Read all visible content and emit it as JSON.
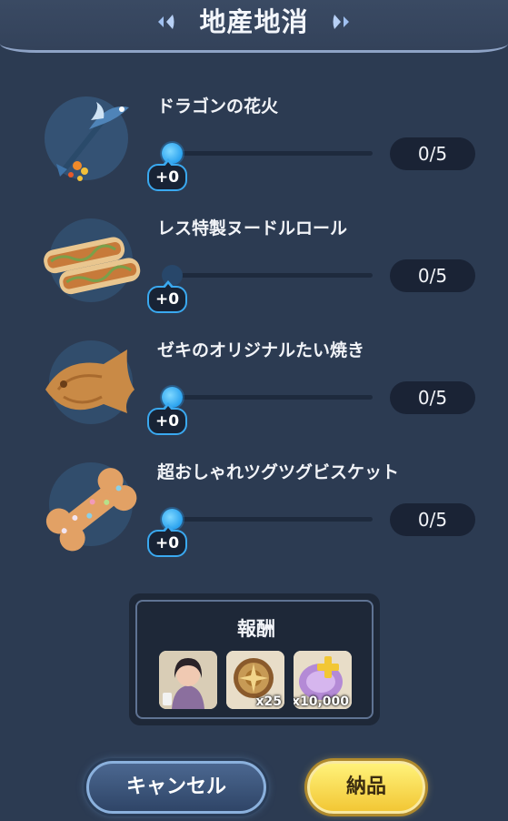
{
  "header": {
    "title": "地産地消"
  },
  "items": [
    {
      "name": "ドラゴンの花火",
      "count": "0/5",
      "delta": "+0",
      "icon": "dragon-firework-icon"
    },
    {
      "name": "レス特製ヌードルロール",
      "count": "0/5",
      "delta": "+0",
      "icon": "noodle-roll-icon"
    },
    {
      "name": "ゼキのオリジナルたい焼き",
      "count": "0/5",
      "delta": "+0",
      "icon": "taiyaki-icon"
    },
    {
      "name": "超おしゃれツグツグビスケット",
      "count": "0/5",
      "delta": "+0",
      "icon": "bone-biscuit-icon"
    }
  ],
  "reward": {
    "title": "報酬",
    "items": [
      {
        "icon": "character-portrait-icon",
        "qty": ""
      },
      {
        "icon": "medal-coin-icon",
        "qty": "x25"
      },
      {
        "icon": "purple-orb-icon",
        "qty": "x10,000"
      }
    ]
  },
  "buttons": {
    "cancel": "キャンセル",
    "submit": "納品"
  },
  "colors": {
    "background": "#2c3b52",
    "accent": "#2aa2ef",
    "submit": "#f2c735"
  }
}
